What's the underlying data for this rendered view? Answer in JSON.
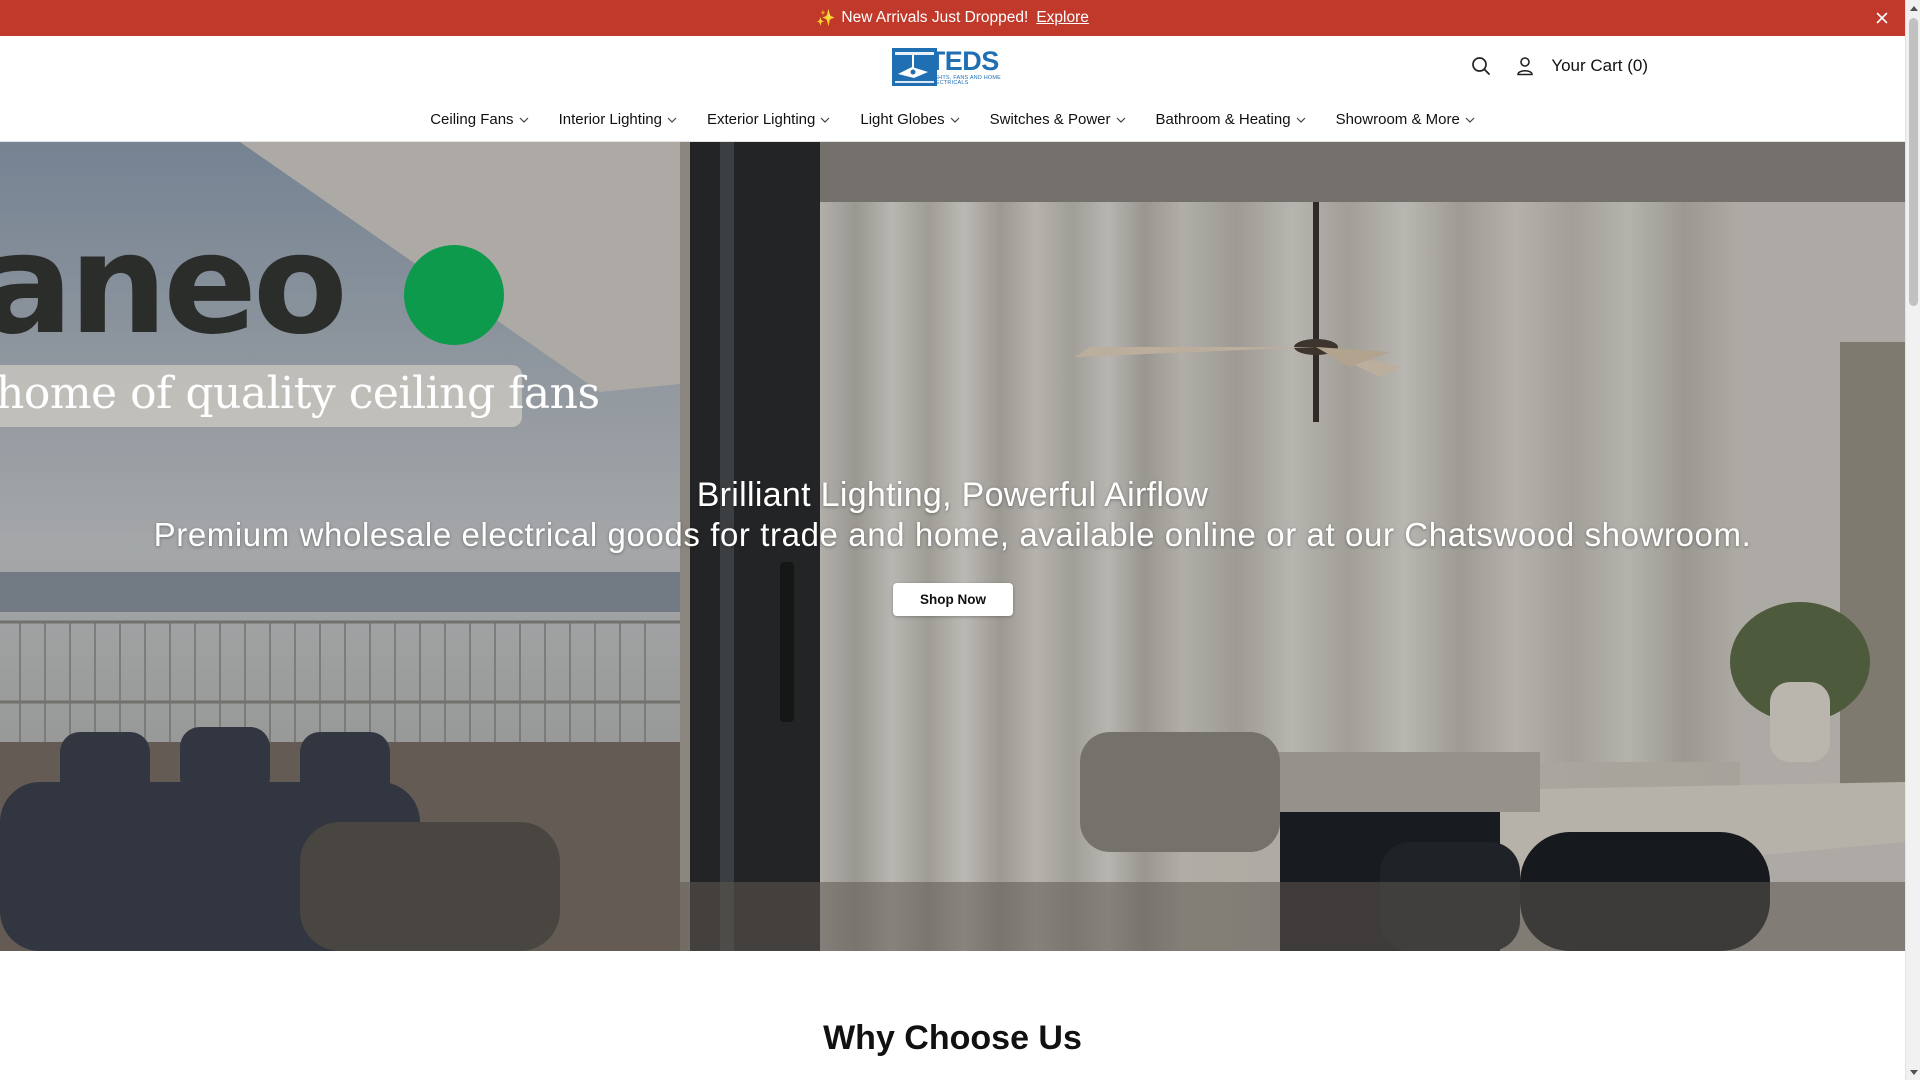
{
  "announcement": {
    "spark": "✨",
    "text": "New Arrivals Just Dropped!",
    "link_label": "Explore",
    "close_icon": "close-icon"
  },
  "header": {
    "logo": {
      "name": "TEDS",
      "tagline": "LIGHTS, FANS AND HOME ELECTRICALS"
    },
    "icons": [
      "search-icon",
      "account-icon"
    ],
    "cart_label": "Your Cart (0)"
  },
  "nav": {
    "items": [
      {
        "label": "Ceiling Fans"
      },
      {
        "label": "Interior Lighting"
      },
      {
        "label": "Exterior Lighting"
      },
      {
        "label": "Light Globes"
      },
      {
        "label": "Switches & Power"
      },
      {
        "label": "Bathroom & Heating"
      },
      {
        "label": "Showroom & More"
      }
    ]
  },
  "hero": {
    "brand_word": "aneo",
    "brand_tagline": "home of quality ceiling fans",
    "title": "Brilliant Lighting, Powerful Airflow",
    "subtitle": "Premium wholesale electrical goods for trade and home, available online or at our Chatswood showroom.",
    "button_label": "Shop Now"
  },
  "section": {
    "heading": "Why Choose Us"
  },
  "colors": {
    "announcement_bg": "#c0392b",
    "brand_blue": "#1f6fb2",
    "brand_green": "#0e9a4c"
  }
}
